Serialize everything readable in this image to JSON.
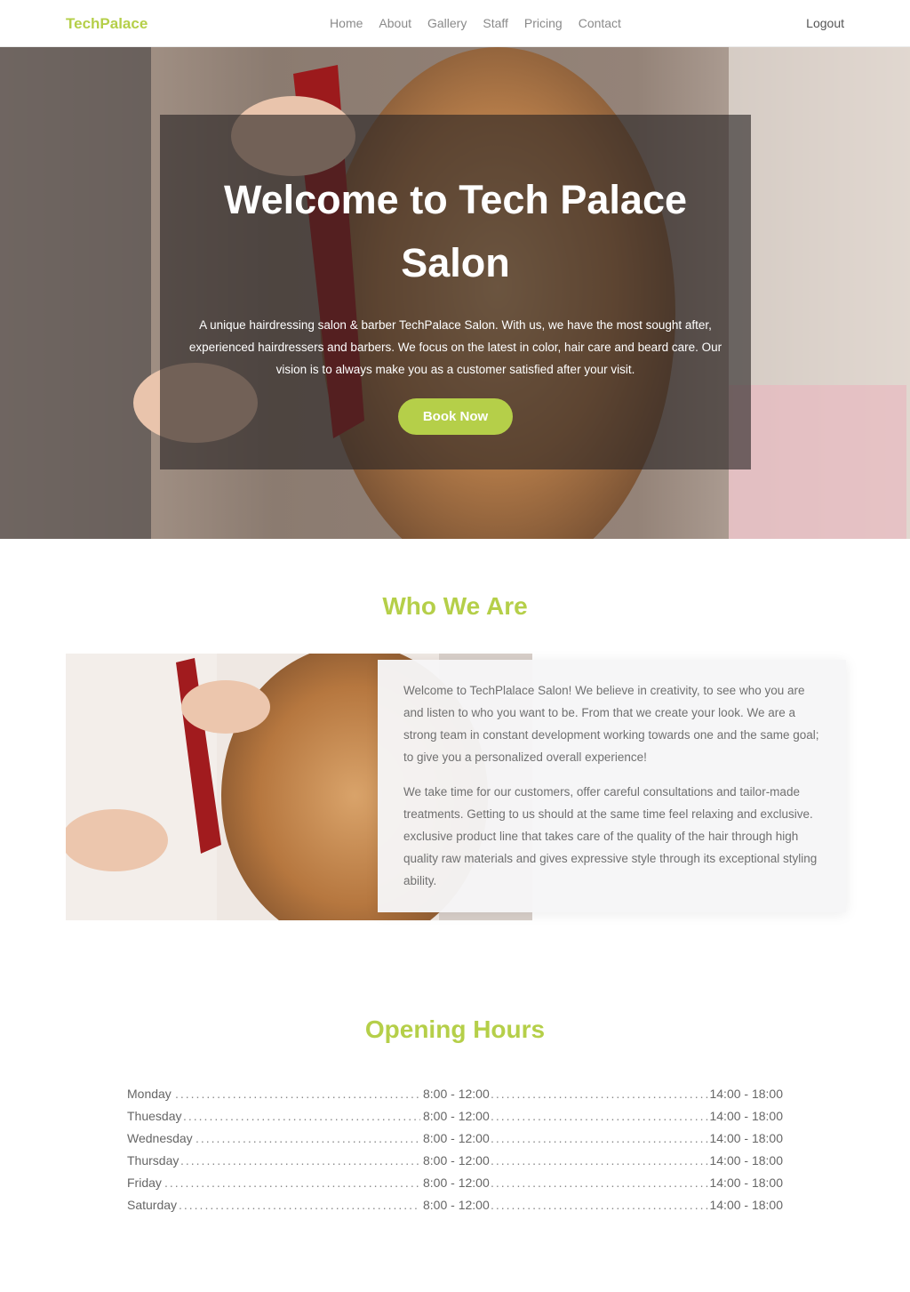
{
  "nav": {
    "brand": "TechPalace",
    "links": [
      "Home",
      "About",
      "Gallery",
      "Staff",
      "Pricing",
      "Contact"
    ],
    "logout": "Logout"
  },
  "hero": {
    "title": "Welcome to Tech Palace Salon",
    "text": "A unique hairdressing salon & barber TechPalace Salon. With us, we have the most sought after, experienced hairdressers and barbers. We focus on the latest in color, hair care and beard care. Our vision is to always make you as a customer satisfied after your visit.",
    "button": "Book Now"
  },
  "who": {
    "title": "Who We Are",
    "p1": "Welcome to TechPlalace Salon! We believe in creativity, to see who you are and listen to who you want to be. From that we create your look. We are a strong team in constant development working towards one and the same goal; to give you a personalized overall experience!",
    "p2": "We take time for our customers, offer careful consultations and tailor-made treatments. Getting to us should at the same time feel relaxing and exclusive. exclusive product line that takes care of the quality of the hair through high quality raw materials and gives expressive style through its exceptional styling ability."
  },
  "hours": {
    "title": "Opening Hours",
    "rows": [
      {
        "day": "Monday",
        "morning": "8:00 - 12:00",
        "afternoon": "14:00 - 18:00"
      },
      {
        "day": "Thuesday",
        "morning": "8:00 - 12:00",
        "afternoon": "14:00 - 18:00"
      },
      {
        "day": "Wednesday",
        "morning": "8:00 - 12:00",
        "afternoon": "14:00 - 18:00"
      },
      {
        "day": "Thursday",
        "morning": "8:00 - 12:00",
        "afternoon": "14:00 - 18:00"
      },
      {
        "day": "Friday",
        "morning": "8:00 - 12:00",
        "afternoon": "14:00 - 18:00"
      },
      {
        "day": "Saturday",
        "morning": "8:00 - 12:00",
        "afternoon": "14:00 - 18:00"
      }
    ]
  },
  "colors": {
    "accent": "#b5cf49",
    "text": "#666666"
  }
}
